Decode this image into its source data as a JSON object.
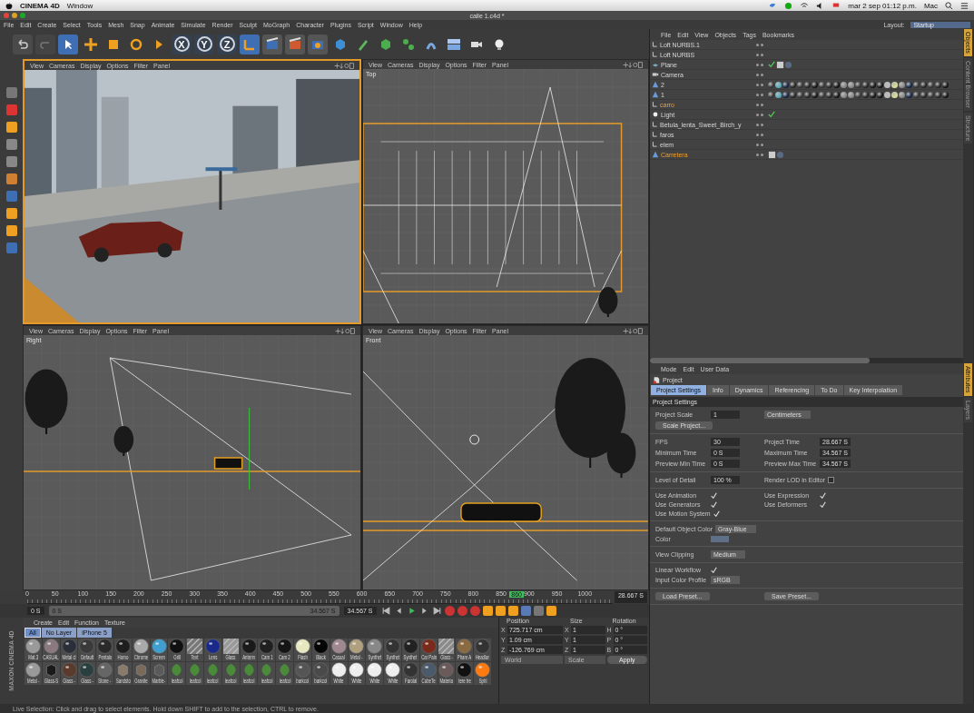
{
  "menubar": {
    "app": "CINEMA 4D",
    "menus": [
      "Window"
    ],
    "date": "mar 2 sep  01:12 p.m.",
    "user": "Mac"
  },
  "window": {
    "title": "calle 1.c4d *"
  },
  "main_menu": [
    "File",
    "Edit",
    "Create",
    "Select",
    "Tools",
    "Mesh",
    "Snap",
    "Animate",
    "Simulate",
    "Render",
    "Sculpt",
    "MoGraph",
    "Character",
    "Plugins",
    "Script",
    "Window",
    "Help"
  ],
  "layout": {
    "label": "Layout:",
    "value": "Startup"
  },
  "axis_buttons": [
    "X",
    "Y",
    "Z"
  ],
  "viewports": [
    {
      "kind": "perspective",
      "active": true,
      "menus": [
        "View",
        "Cameras",
        "Display",
        "Options",
        "Filter",
        "Panel"
      ]
    },
    {
      "kind": "top",
      "label": "Top",
      "active": false,
      "menus": [
        "View",
        "Cameras",
        "Display",
        "Options",
        "Filter",
        "Panel"
      ]
    },
    {
      "kind": "right",
      "label": "Right",
      "active": false,
      "menus": [
        "View",
        "Cameras",
        "Display",
        "Options",
        "Filter",
        "Panel"
      ]
    },
    {
      "kind": "front",
      "label": "Front",
      "active": false,
      "menus": [
        "View",
        "Cameras",
        "Display",
        "Options",
        "Filter",
        "Panel"
      ]
    }
  ],
  "timeline": {
    "ticks": [
      "0",
      "50",
      "100",
      "150",
      "200",
      "250",
      "300",
      "350",
      "400",
      "450",
      "500",
      "550",
      "600",
      "650",
      "700",
      "750",
      "800",
      "850",
      "900",
      "950",
      "1000"
    ],
    "playhead": {
      "label": "860",
      "level": 0.86
    },
    "end": "28.667 S",
    "start_field": "0 S",
    "range": {
      "start": "0 S",
      "end": "34.567 S",
      "level": 1
    },
    "end_field": "34.567 S"
  },
  "materials": {
    "brand": "MAXON CINEMA 4D",
    "menus": [
      "Create",
      "Edit",
      "Function",
      "Texture"
    ],
    "filters": [
      {
        "label": "All",
        "selected": true
      },
      {
        "label": "No Layer",
        "selected": false
      },
      {
        "label": "iPhone 5",
        "selected": false
      }
    ],
    "rows": [
      [
        {
          "label": "Mat.3",
          "kind": "sphere",
          "color": "#9a9a9a"
        },
        {
          "label": "CASUAL",
          "kind": "sphere",
          "color": "#8a7a80"
        },
        {
          "label": "Metal cl",
          "kind": "sphere",
          "color": "#2a2f3a"
        },
        {
          "label": "Default",
          "kind": "sphere",
          "color": "#3a3a3a"
        },
        {
          "label": "Pentalo",
          "kind": "sphere",
          "color": "#2a2a2a"
        },
        {
          "label": "Horno",
          "kind": "sphere",
          "color": "#1e1e1e"
        },
        {
          "label": "Chrome",
          "kind": "sphere",
          "color": "#aaaaaa"
        },
        {
          "label": "Screen",
          "kind": "sphere",
          "color": "#3fa0d0"
        },
        {
          "label": "Grill",
          "kind": "sphere",
          "color": "#111111"
        },
        {
          "label": "Text",
          "kind": "stripes",
          "color": "#777777"
        },
        {
          "label": "Lens",
          "kind": "sphere",
          "color": "#1a2a8a"
        },
        {
          "label": "Glass",
          "kind": "stripes",
          "color": "#999999"
        },
        {
          "label": "Antenn",
          "kind": "sphere",
          "color": "#1a1a1a"
        },
        {
          "label": "Cam 1",
          "kind": "sphere",
          "color": "#202020"
        },
        {
          "label": "Cam 2",
          "kind": "sphere",
          "color": "#151515"
        },
        {
          "label": "Flash",
          "kind": "sphere",
          "color": "#e8e8c0"
        },
        {
          "label": "Black",
          "kind": "sphere",
          "color": "#050505"
        },
        {
          "label": "Casual",
          "kind": "sphere",
          "color": "#a08890"
        },
        {
          "label": "Metal -",
          "kind": "sphere",
          "color": "#b0a080"
        },
        {
          "label": "Synthet",
          "kind": "sphere",
          "color": "#888888"
        },
        {
          "label": "Synthet",
          "kind": "sphere",
          "color": "#333333"
        },
        {
          "label": "Synthet",
          "kind": "sphere",
          "color": "#222222"
        },
        {
          "label": "Car Pain",
          "kind": "sphere",
          "color": "#7a2a1a"
        },
        {
          "label": "Glass -",
          "kind": "stripes",
          "color": "#8a8a8a"
        },
        {
          "label": "Phare A",
          "kind": "sphere",
          "color": "#8a6a40"
        },
        {
          "label": "Headlar",
          "kind": "sphere",
          "color": "#333333"
        }
      ],
      [
        {
          "label": "Metal -",
          "kind": "sphere",
          "color": "#9a9a9a"
        },
        {
          "label": "Glass-S",
          "kind": "cube",
          "color": "#1a1a1a"
        },
        {
          "label": "Glass -",
          "kind": "sphere",
          "color": "#5a3a2a"
        },
        {
          "label": "Glass -",
          "kind": "sphere",
          "color": "#2a4040"
        },
        {
          "label": "Stone -",
          "kind": "sphere",
          "color": "#666666"
        },
        {
          "label": "Sandsto",
          "kind": "cube",
          "color": "#8a7a6a"
        },
        {
          "label": "Granite",
          "kind": "cube",
          "color": "#7a6a5a"
        },
        {
          "label": "Marble-",
          "kind": "cube",
          "color": "#5a5a5a"
        },
        {
          "label": "leafcol",
          "kind": "leaf",
          "color": "#4a8a3a"
        },
        {
          "label": "leafcol",
          "kind": "leaf",
          "color": "#4a8a3a"
        },
        {
          "label": "leafcol",
          "kind": "leaf",
          "color": "#4a8a3a"
        },
        {
          "label": "leafcol",
          "kind": "leaf",
          "color": "#4a8a3a"
        },
        {
          "label": "leafcol",
          "kind": "leaf",
          "color": "#4a8a3a"
        },
        {
          "label": "leafcol",
          "kind": "leaf",
          "color": "#4a8a3a"
        },
        {
          "label": "leafcol",
          "kind": "leaf",
          "color": "#4a8a3a"
        },
        {
          "label": "barkcol",
          "kind": "sphere",
          "color": "#555555"
        },
        {
          "label": "barkcol",
          "kind": "sphere",
          "color": "#4a4a4a"
        },
        {
          "label": "White",
          "kind": "sphere",
          "color": "#eeeeee"
        },
        {
          "label": "White",
          "kind": "sphere",
          "color": "#eeeeee"
        },
        {
          "label": "White",
          "kind": "sphere",
          "color": "#eeeeee"
        },
        {
          "label": "White",
          "kind": "sphere",
          "color": "#eeeeee"
        },
        {
          "label": "Farolal",
          "kind": "sphere",
          "color": "#333333"
        },
        {
          "label": "CubeTe",
          "kind": "sphere",
          "color": "#4a5a6a"
        },
        {
          "label": "Materia",
          "kind": "sphere",
          "color": "#6a5a5a"
        },
        {
          "label": "tere tre",
          "kind": "sphere",
          "color": "#111111"
        },
        {
          "label": "Sphl",
          "kind": "sphere",
          "color": "#ff7a10"
        }
      ]
    ]
  },
  "coordinates": {
    "headers": [
      "Position",
      "Size",
      "Rotation"
    ],
    "rows": [
      {
        "pos_axis": "X",
        "pos": "725.717 cm",
        "size_axis": "X",
        "size": "1",
        "rot_axis": "H",
        "rot": "0 °"
      },
      {
        "pos_axis": "Y",
        "pos": "1.09 cm",
        "size_axis": "Y",
        "size": "1",
        "rot_axis": "P",
        "rot": "0 °"
      },
      {
        "pos_axis": "Z",
        "pos": "-126.769 cm",
        "size_axis": "Z",
        "size": "1",
        "rot_axis": "B",
        "rot": "0 °"
      }
    ],
    "modes": [
      "World",
      "Scale"
    ],
    "apply": "Apply"
  },
  "status_bar": "Live Selection: Click and drag to select elements. Hold down SHIFT to add to the selection, CTRL to remove.",
  "object_manager": {
    "menus": [
      "File",
      "Edit",
      "View",
      "Objects",
      "Tags",
      "Bookmarks"
    ],
    "side_tabs": [
      {
        "label": "Objects",
        "selected": true
      },
      {
        "label": "Content Browser",
        "selected": false
      },
      {
        "label": "Structure",
        "selected": false
      }
    ],
    "objects": [
      {
        "name": "Loft NURBS.1",
        "kind": "nurbs",
        "highlighted": false,
        "check_tag": false,
        "material_tags": false,
        "texture_tags": false
      },
      {
        "name": "Loft NURBS",
        "kind": "nurbs",
        "highlighted": false,
        "check_tag": false,
        "material_tags": false,
        "texture_tags": false
      },
      {
        "name": "Plane",
        "kind": "plane",
        "highlighted": false,
        "check_tag": true,
        "material_tags": false,
        "texture_tags": true
      },
      {
        "name": "Camera",
        "kind": "camera",
        "highlighted": false,
        "check_tag": false,
        "material_tags": false,
        "texture_tags": false
      },
      {
        "name": "2",
        "kind": "figure",
        "highlighted": false,
        "check_tag": false,
        "material_tags": true,
        "texture_tags": false
      },
      {
        "name": "1",
        "kind": "figure",
        "highlighted": false,
        "check_tag": false,
        "material_tags": true,
        "texture_tags": false
      },
      {
        "name": "carro",
        "kind": "nurbs",
        "highlighted": true,
        "check_tag": false,
        "material_tags": false,
        "texture_tags": false
      },
      {
        "name": "Light",
        "kind": "light",
        "highlighted": false,
        "check_tag": true,
        "material_tags": false,
        "texture_tags": false
      },
      {
        "name": "Betula_lenta_Sweet_Birch_y",
        "kind": "nurbs",
        "highlighted": false,
        "check_tag": false,
        "material_tags": false,
        "texture_tags": false
      },
      {
        "name": "faros",
        "kind": "nurbs",
        "highlighted": false,
        "check_tag": false,
        "material_tags": false,
        "texture_tags": false
      },
      {
        "name": "elem",
        "kind": "nurbs",
        "highlighted": false,
        "check_tag": false,
        "material_tags": false,
        "texture_tags": false
      },
      {
        "name": "Carretera",
        "kind": "figure",
        "highlighted": true,
        "check_tag": false,
        "material_tags": false,
        "texture_tags": true
      }
    ]
  },
  "attributes": {
    "menus": [
      "Mode",
      "Edit",
      "User Data"
    ],
    "object": "Project",
    "side_tabs": [
      {
        "label": "Attributes",
        "selected": true
      },
      {
        "label": "Layers",
        "selected": false
      }
    ],
    "tabs": [
      {
        "label": "Project Settings",
        "selected": true
      },
      {
        "label": "Info",
        "selected": false
      },
      {
        "label": "Dynamics",
        "selected": false
      },
      {
        "label": "Referencing",
        "selected": false
      },
      {
        "label": "To Do",
        "selected": false
      },
      {
        "label": "Key Interpolation",
        "selected": false
      }
    ],
    "section": "Project Settings",
    "groups": [
      [
        [
          {
            "kind": "field",
            "label": "Project Scale",
            "value": "1"
          },
          {
            "kind": "dropdown",
            "value": "Centimeters"
          }
        ],
        [
          {
            "kind": "button",
            "value": "Scale Project..."
          }
        ]
      ],
      [
        [
          {
            "kind": "field",
            "label": "FPS",
            "value": "30"
          },
          {
            "kind": "field",
            "label": "Project Time",
            "value": "28.667 S"
          }
        ],
        [
          {
            "kind": "field",
            "label": "Minimum Time",
            "value": "0 S"
          },
          {
            "kind": "field",
            "label": "Maximum Time",
            "value": "34.567 S"
          }
        ],
        [
          {
            "kind": "field",
            "label": "Preview Min Time",
            "value": "0 S"
          },
          {
            "kind": "field",
            "label": "Preview Max Time",
            "value": "34.567 S"
          }
        ]
      ],
      [
        [
          {
            "kind": "field",
            "label": "Level of Detail",
            "value": "100 %"
          },
          {
            "kind": "check",
            "label": "Render LOD in Editor",
            "checked": false
          }
        ]
      ],
      [
        [
          {
            "kind": "check",
            "label": "Use Animation",
            "checked": true
          },
          {
            "kind": "check",
            "label": "Use Expression",
            "checked": true
          }
        ],
        [
          {
            "kind": "check",
            "label": "Use Generators",
            "checked": true
          },
          {
            "kind": "check",
            "label": "Use Deformers",
            "checked": true
          }
        ],
        [
          {
            "kind": "check",
            "label": "Use Motion System",
            "checked": true
          }
        ]
      ],
      [
        [
          {
            "kind": "dropdown",
            "label": "Default Object Color",
            "value": "Gray-Blue"
          }
        ],
        [
          {
            "kind": "swatch",
            "label": "Color",
            "color": "#5f6f85"
          }
        ]
      ],
      [
        [
          {
            "kind": "dropdown",
            "label": "View Clipping",
            "value": "Medium"
          }
        ]
      ],
      [
        [
          {
            "kind": "check",
            "label": "Linear Workflow",
            "checked": true
          }
        ],
        [
          {
            "kind": "dropdown",
            "label": "Input Color Profile",
            "value": "sRGB"
          }
        ]
      ],
      [
        [
          {
            "kind": "button",
            "value": "Load Preset..."
          },
          {
            "kind": "button",
            "value": "Save Preset..."
          }
        ]
      ]
    ]
  }
}
